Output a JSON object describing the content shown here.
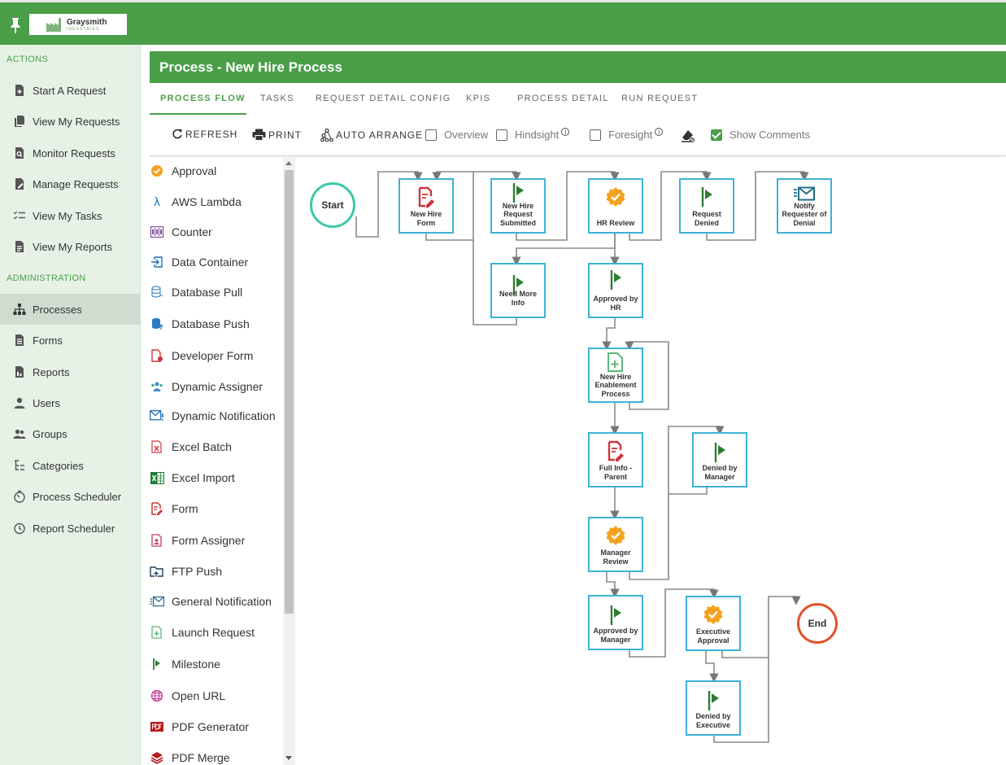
{
  "brand": {
    "name": "Graysmith",
    "sub": "INDUSTRIES"
  },
  "sidebar": {
    "actions_heading": "ACTIONS",
    "admin_heading": "ADMINISTRATION",
    "actions": [
      {
        "label": "Start A Request",
        "icon": "add-file-icon"
      },
      {
        "label": "View My Requests",
        "icon": "files-icon"
      },
      {
        "label": "Monitor Requests",
        "icon": "search-file-icon"
      },
      {
        "label": "Manage Requests",
        "icon": "edit-file-icon"
      },
      {
        "label": "View My Tasks",
        "icon": "checklist-icon"
      },
      {
        "label": "View My Reports",
        "icon": "report-icon"
      }
    ],
    "admin": [
      {
        "label": "Processes",
        "icon": "sitemap-icon",
        "active": true
      },
      {
        "label": "Forms",
        "icon": "form-icon"
      },
      {
        "label": "Reports",
        "icon": "report-icon"
      },
      {
        "label": "Users",
        "icon": "user-icon"
      },
      {
        "label": "Groups",
        "icon": "group-icon"
      },
      {
        "label": "Categories",
        "icon": "tree-icon"
      },
      {
        "label": "Process Scheduler",
        "icon": "timer-icon"
      },
      {
        "label": "Report Scheduler",
        "icon": "clock-icon"
      }
    ]
  },
  "header": {
    "title": "Process - New Hire Process"
  },
  "tabs": [
    "PROCESS FLOW",
    "TASKS",
    "REQUEST DETAIL CONFIG",
    "KPIS",
    "PROCESS DETAIL",
    "RUN REQUEST"
  ],
  "toolbar": {
    "refresh": "REFRESH",
    "print": "PRINT",
    "auto_arrange": "AUTO ARRANGE",
    "overview": "Overview",
    "hindsight": "Hindsight",
    "foresight": "Foresight",
    "show_comments": "Show Comments",
    "info_glyph": "i"
  },
  "palette": [
    {
      "label": "Approval",
      "icon": "approval-badge-icon"
    },
    {
      "label": "AWS Lambda",
      "icon": "lambda-icon"
    },
    {
      "label": "Counter",
      "icon": "counter-icon"
    },
    {
      "label": "Data Container",
      "icon": "data-container-icon"
    },
    {
      "label": "Database Pull",
      "icon": "database-pull-icon"
    },
    {
      "label": "Database Push",
      "icon": "database-push-icon"
    },
    {
      "label": "Developer Form",
      "icon": "developer-form-icon"
    },
    {
      "label": "Dynamic Assigner",
      "icon": "dynamic-assigner-icon"
    },
    {
      "label": "Dynamic Notification",
      "icon": "dynamic-notification-icon"
    },
    {
      "label": "Excel Batch",
      "icon": "excel-batch-icon"
    },
    {
      "label": "Excel Import",
      "icon": "excel-import-icon"
    },
    {
      "label": "Form",
      "icon": "form-edit-icon"
    },
    {
      "label": "Form Assigner",
      "icon": "form-assigner-icon"
    },
    {
      "label": "FTP Push",
      "icon": "ftp-push-icon"
    },
    {
      "label": "General Notification",
      "icon": "general-notification-icon"
    },
    {
      "label": "Launch Request",
      "icon": "launch-request-icon"
    },
    {
      "label": "Milestone",
      "icon": "flag-icon"
    },
    {
      "label": "Open URL",
      "icon": "globe-icon"
    },
    {
      "label": "PDF Generator",
      "icon": "pdf-icon"
    },
    {
      "label": "PDF Merge",
      "icon": "layers-icon"
    }
  ],
  "flow": {
    "start": "Start",
    "end": "End",
    "nodes": [
      {
        "label": "New Hire Form",
        "type": "form"
      },
      {
        "label": "New Hire Request Submitted",
        "type": "milestone"
      },
      {
        "label": "HR Review",
        "type": "approval"
      },
      {
        "label": "Request Denied",
        "type": "milestone"
      },
      {
        "label": "Notify Requester of Denial",
        "type": "notification"
      },
      {
        "label": "Need More Info",
        "type": "milestone"
      },
      {
        "label": "Approved by HR",
        "type": "milestone"
      },
      {
        "label": "New Hire Enablement Process",
        "type": "launch"
      },
      {
        "label": "Full Info - Parent",
        "type": "form"
      },
      {
        "label": "Denied by Manager",
        "type": "milestone"
      },
      {
        "label": "Manager Review",
        "type": "approval"
      },
      {
        "label": "Approved by Manager",
        "type": "milestone"
      },
      {
        "label": "Executive Approval",
        "type": "approval"
      },
      {
        "label": "Denied by Executive",
        "type": "milestone"
      }
    ]
  },
  "colors": {
    "brand_green": "#4a9e48",
    "node_border": "#3cb2d6",
    "start": "#3cc9a8",
    "end": "#e0532a"
  }
}
